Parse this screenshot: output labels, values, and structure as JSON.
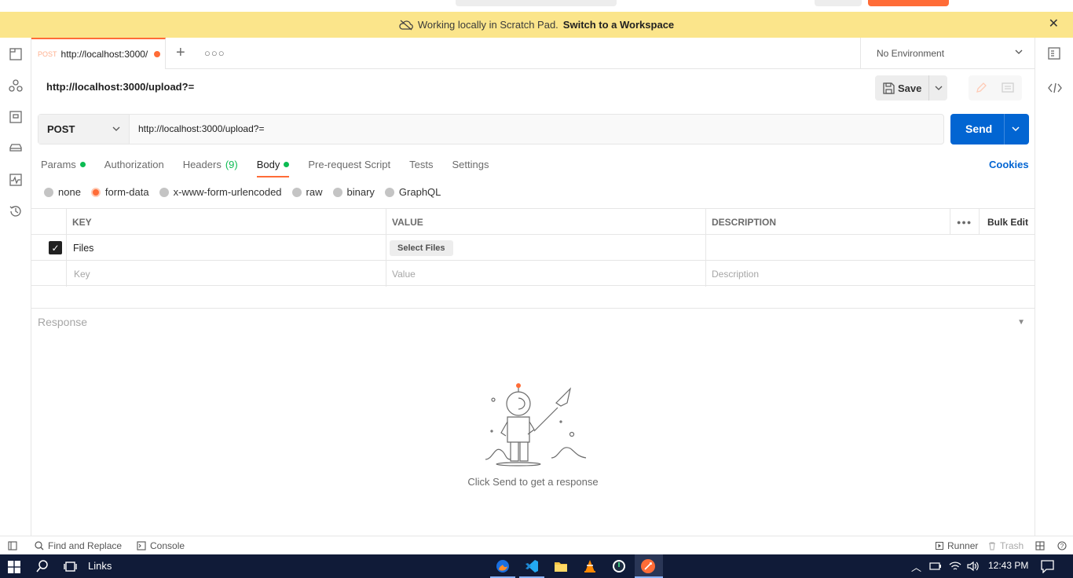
{
  "banner": {
    "text": "Working locally in Scratch Pad.",
    "link": "Switch to a Workspace"
  },
  "tab": {
    "method": "POST",
    "title": "http://localhost:3000/"
  },
  "environment": {
    "label": "No Environment"
  },
  "request": {
    "title": "http://localhost:3000/upload?=",
    "save_label": "Save",
    "method": "POST",
    "url": "http://localhost:3000/upload?=",
    "send_label": "Send"
  },
  "subtabs": {
    "params": "Params",
    "authorization": "Authorization",
    "headers": "Headers",
    "headers_count": "(9)",
    "body": "Body",
    "prerequest": "Pre-request Script",
    "tests": "Tests",
    "settings": "Settings",
    "cookies": "Cookies"
  },
  "body_types": {
    "none": "none",
    "form_data": "form-data",
    "urlencoded": "x-www-form-urlencoded",
    "raw": "raw",
    "binary": "binary",
    "graphql": "GraphQL",
    "selected": "form-data"
  },
  "table": {
    "headers": {
      "key": "KEY",
      "value": "VALUE",
      "description": "DESCRIPTION",
      "bulk_edit": "Bulk Edit"
    },
    "rows": [
      {
        "key": "Files",
        "value_button": "Select Files",
        "checked": true
      }
    ],
    "placeholder": {
      "key": "Key",
      "value": "Value",
      "description": "Description"
    }
  },
  "response": {
    "label": "Response",
    "empty_message": "Click Send to get a response"
  },
  "statusbar": {
    "find_replace": "Find and Replace",
    "console": "Console",
    "runner": "Runner",
    "trash": "Trash"
  },
  "taskbar": {
    "links": "Links",
    "time": "12:43 PM"
  },
  "colors": {
    "accent": "#ff6c37",
    "send_blue": "#0265d2",
    "banner_yellow": "#fbe58b",
    "status_green": "#0cbb52",
    "taskbar": "#101b38"
  }
}
